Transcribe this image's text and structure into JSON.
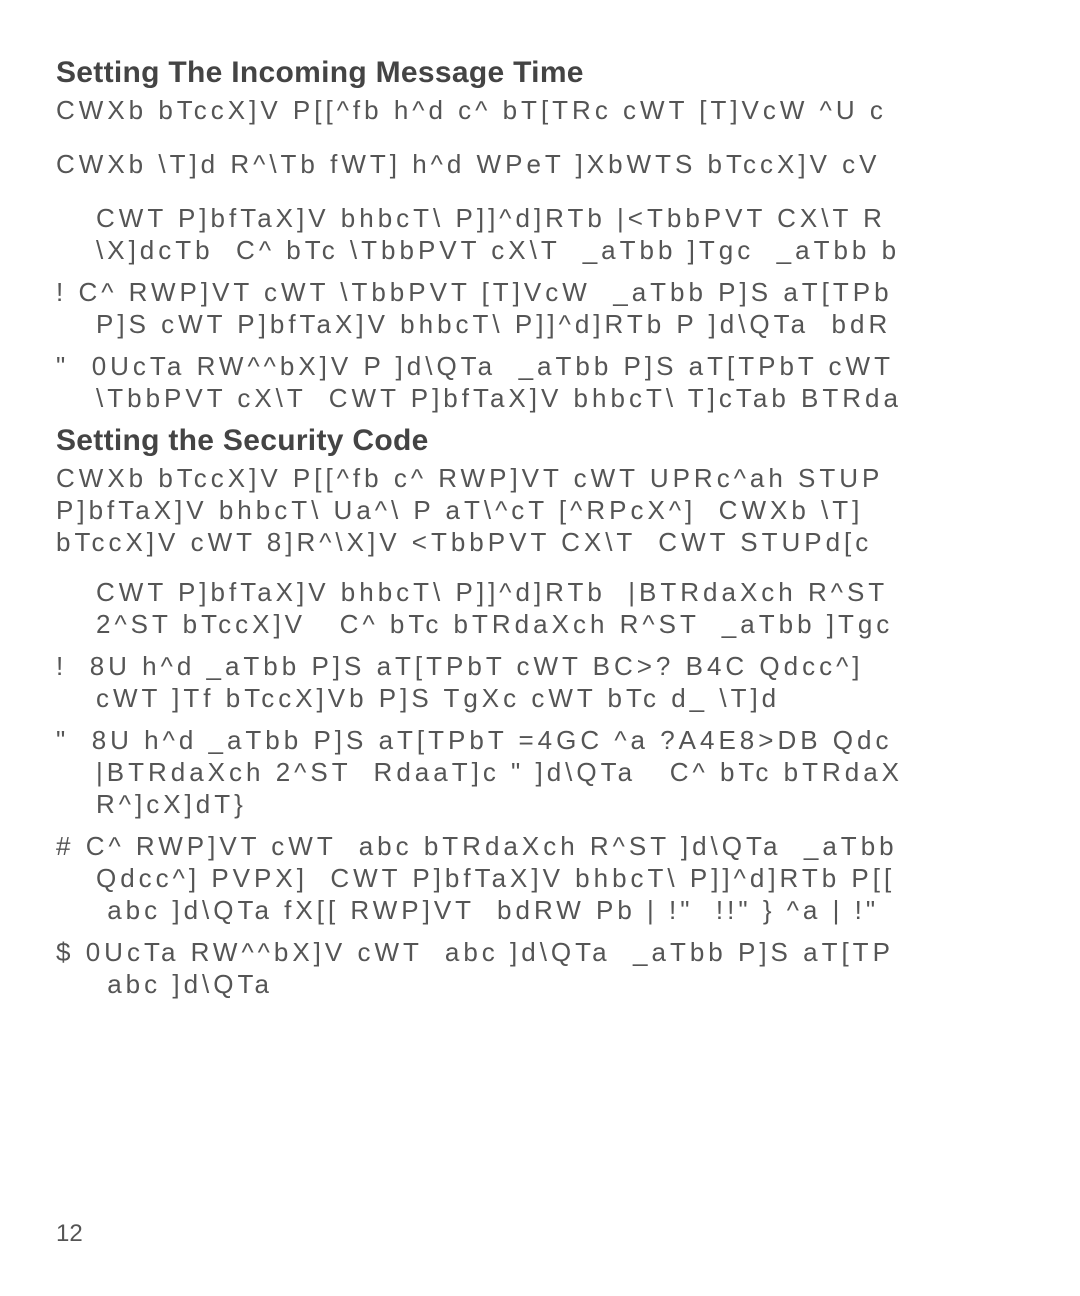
{
  "section1": {
    "heading": "Setting The Incoming Message Time",
    "p1": "CWXb bTccX]V P[[^fb h^d c^ bT[TRc cWT [T]VcW ^U c",
    "p2": "CWXb \\T]d R^\\Tb fWT] h^d WPeT ]XbWTS bTccX]V cV",
    "items": [
      {
        "marker": " ",
        "l1": "CWT P]bfTaX]V bhbcT\\ P]]^d]RTb |<TbbPVT CX\\T R",
        "l2": "\\X]dcTb  C^ bTc \\TbbPVT cX\\T  _aTbb ]Tgc  _aTbb b"
      },
      {
        "marker": "!",
        "l1": "C^ RWP]VT cWT \\TbbPVT [T]VcW  _aTbb P]S aT[TPb",
        "l2": "P]S cWT P]bfTaX]V bhbcT\\ P]]^d]RTb P ]d\\QTa  bdR"
      },
      {
        "marker": "\"",
        "l1": "0UcTa RW^^bX]V P ]d\\QTa  _aTbb P]S aT[TPbT cWT",
        "l2": "\\TbbPVT cX\\T  CWT P]bfTaX]V bhbcT\\ T]cTab BTRda"
      }
    ]
  },
  "section2": {
    "heading": "Setting the Security Code",
    "p1a": "CWXb bTccX]V P[[^fb c^ RWP]VT cWT UPRc^ah STUP",
    "p1b": "P]bfTaX]V bhbcT\\ Ua^\\ P aT\\^cT [^RPcX^]  CWXb \\T]",
    "p1c": "bTccX]V cWT 8]R^\\X]V <TbbPVT CX\\T  CWT STUPd[c",
    "items": [
      {
        "marker": " ",
        "lines": [
          "CWT P]bfTaX]V bhbcT\\ P]]^d]RTb  |BTRdaXch R^ST",
          "2^ST bTccX]V   C^ bTc bTRdaXch R^ST  _aTbb ]Tgc"
        ]
      },
      {
        "marker": "!",
        "lines": [
          " 8U h^d _aTbb P]S aT[TPbT cWT BC>? B4C Qdcc^]",
          "cWT ]Tf bTccX]Vb P]S TgXc cWT bTc d_ \\T]d"
        ]
      },
      {
        "marker": "\"",
        "lines": [
          " 8U h^d _aTbb P]S aT[TPbT =4GC ^a ?A4E8>DB Qdc",
          "|BTRdaXch 2^ST  RdaaT]c \" ]d\\QTa   C^ bTc bTRdaX",
          "R^]cX]dT}"
        ]
      },
      {
        "marker": "#",
        "lines": [
          "C^ RWP]VT cWT  abc bTRdaXch R^ST ]d\\QTa  _aTbb",
          "Qdcc^] PVPX]  CWT P]bfTaX]V bhbcT\\ P]]^d]RTb P[[",
          " abc ]d\\QTa fX[[ RWP]VT  bdRW Pb | !\"  !!\" } ^a | !\""
        ]
      },
      {
        "marker": "$",
        "lines": [
          "0UcTa RW^^bX]V cWT  abc ]d\\QTa  _aTbb P]S aT[TP",
          " abc ]d\\QTa"
        ]
      }
    ]
  },
  "page_number": "12"
}
